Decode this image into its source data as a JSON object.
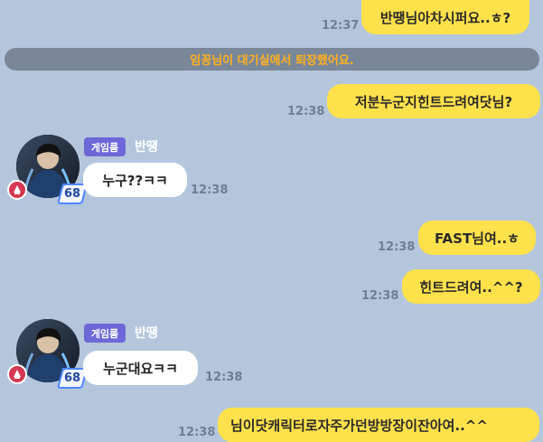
{
  "messages": [
    {
      "text": "반땡님아차시퍼요..ㅎ?",
      "time": "12:37"
    },
    {
      "text": "저분누군지힌트드려여닷님?",
      "time": "12:38"
    },
    {
      "text": "누구??ㅋㅋ",
      "time": "12:38"
    },
    {
      "text": "FAST님여..ㅎ",
      "time": "12:38"
    },
    {
      "text": "힌트드려여..^^?",
      "time": "12:38"
    },
    {
      "text": "누군대요ㅋㅋ",
      "time": "12:38"
    },
    {
      "text": "님이닷캐릭터로자주가던방방장이잔아여..^^",
      "time": "12:38"
    }
  ],
  "system_notice": "임꽁님이 대기실에서 퇴장했어요.",
  "sender": {
    "room_badge": "게임룸",
    "name": "반땡",
    "level": "68"
  },
  "colors": {
    "background": "#b3c6dc",
    "my_bubble": "#ffe14b",
    "their_bubble": "#ffffff",
    "system_text": "#ffb11c",
    "system_bar": "#7a8799",
    "badge": "#6d67d8"
  },
  "icons": {
    "award": "award-medal-icon",
    "level": "level-badge-icon"
  }
}
